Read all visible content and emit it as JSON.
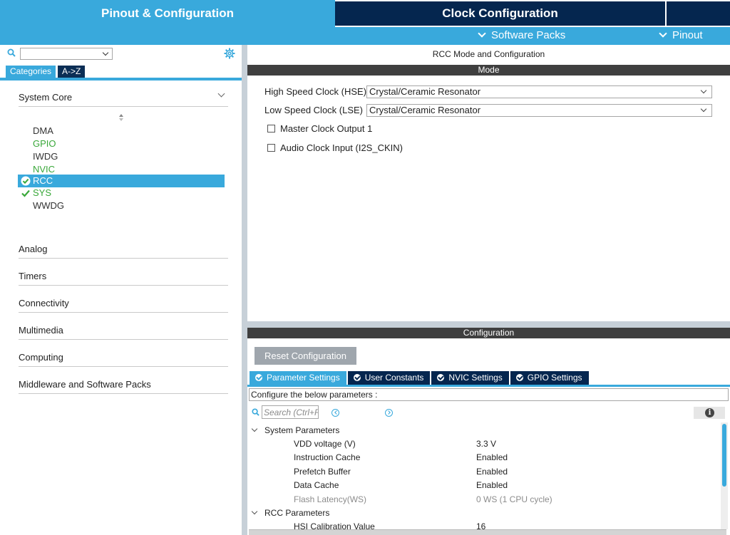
{
  "top_tabs": {
    "pinout_config": "Pinout & Configuration",
    "clock_config": "Clock Configuration"
  },
  "sub_menu": {
    "software_packs": "Software Packs",
    "pinout": "Pinout"
  },
  "left": {
    "categories_tab": "Categories",
    "az_tab": "A->Z",
    "groups": [
      {
        "label": "System Core",
        "expanded": true
      },
      {
        "label": "Analog"
      },
      {
        "label": "Timers"
      },
      {
        "label": "Connectivity"
      },
      {
        "label": "Multimedia"
      },
      {
        "label": "Computing"
      },
      {
        "label": "Middleware and Software Packs"
      }
    ],
    "peripherals": [
      {
        "label": "DMA",
        "state": "normal"
      },
      {
        "label": "GPIO",
        "state": "configured"
      },
      {
        "label": "IWDG",
        "state": "normal"
      },
      {
        "label": "NVIC",
        "state": "configured"
      },
      {
        "label": "RCC",
        "state": "selected"
      },
      {
        "label": "SYS",
        "state": "checked"
      },
      {
        "label": "WWDG",
        "state": "normal"
      }
    ]
  },
  "right": {
    "title": "RCC Mode and Configuration",
    "mode_header": "Mode",
    "hse_label": "High Speed Clock (HSE)",
    "hse_value": "Crystal/Ceramic Resonator",
    "lse_label": "Low Speed Clock (LSE)",
    "lse_value": "Crystal/Ceramic Resonator",
    "mco_label": "Master Clock Output 1",
    "i2s_label": "Audio Clock Input (I2S_CKIN)",
    "config_header": "Configuration",
    "reset_button": "Reset Configuration",
    "param_tabs": [
      "Parameter Settings",
      "User Constants",
      "NVIC Settings",
      "GPIO Settings"
    ],
    "configure_text": "Configure the below parameters :",
    "search_placeholder": "Search (Ctrl+F)",
    "info_icon_glyph": "i",
    "tree": {
      "system_params": "System Parameters",
      "rows": [
        {
          "name": "VDD voltage (V)",
          "value": "3.3 V"
        },
        {
          "name": "Instruction Cache",
          "value": "Enabled"
        },
        {
          "name": "Prefetch Buffer",
          "value": "Enabled"
        },
        {
          "name": "Data Cache",
          "value": "Enabled"
        },
        {
          "name": "Flash Latency(WS)",
          "value": "0 WS (1 CPU cycle)",
          "disabled": true
        }
      ],
      "rcc_params": "RCC Parameters",
      "hsi_row": {
        "name": "HSI Calibration Value",
        "value": "16"
      }
    }
  },
  "colors": {
    "accent": "#39a9dc",
    "navy": "#05264f",
    "green": "#3aa83a",
    "header_dark": "#3f3f3f"
  }
}
